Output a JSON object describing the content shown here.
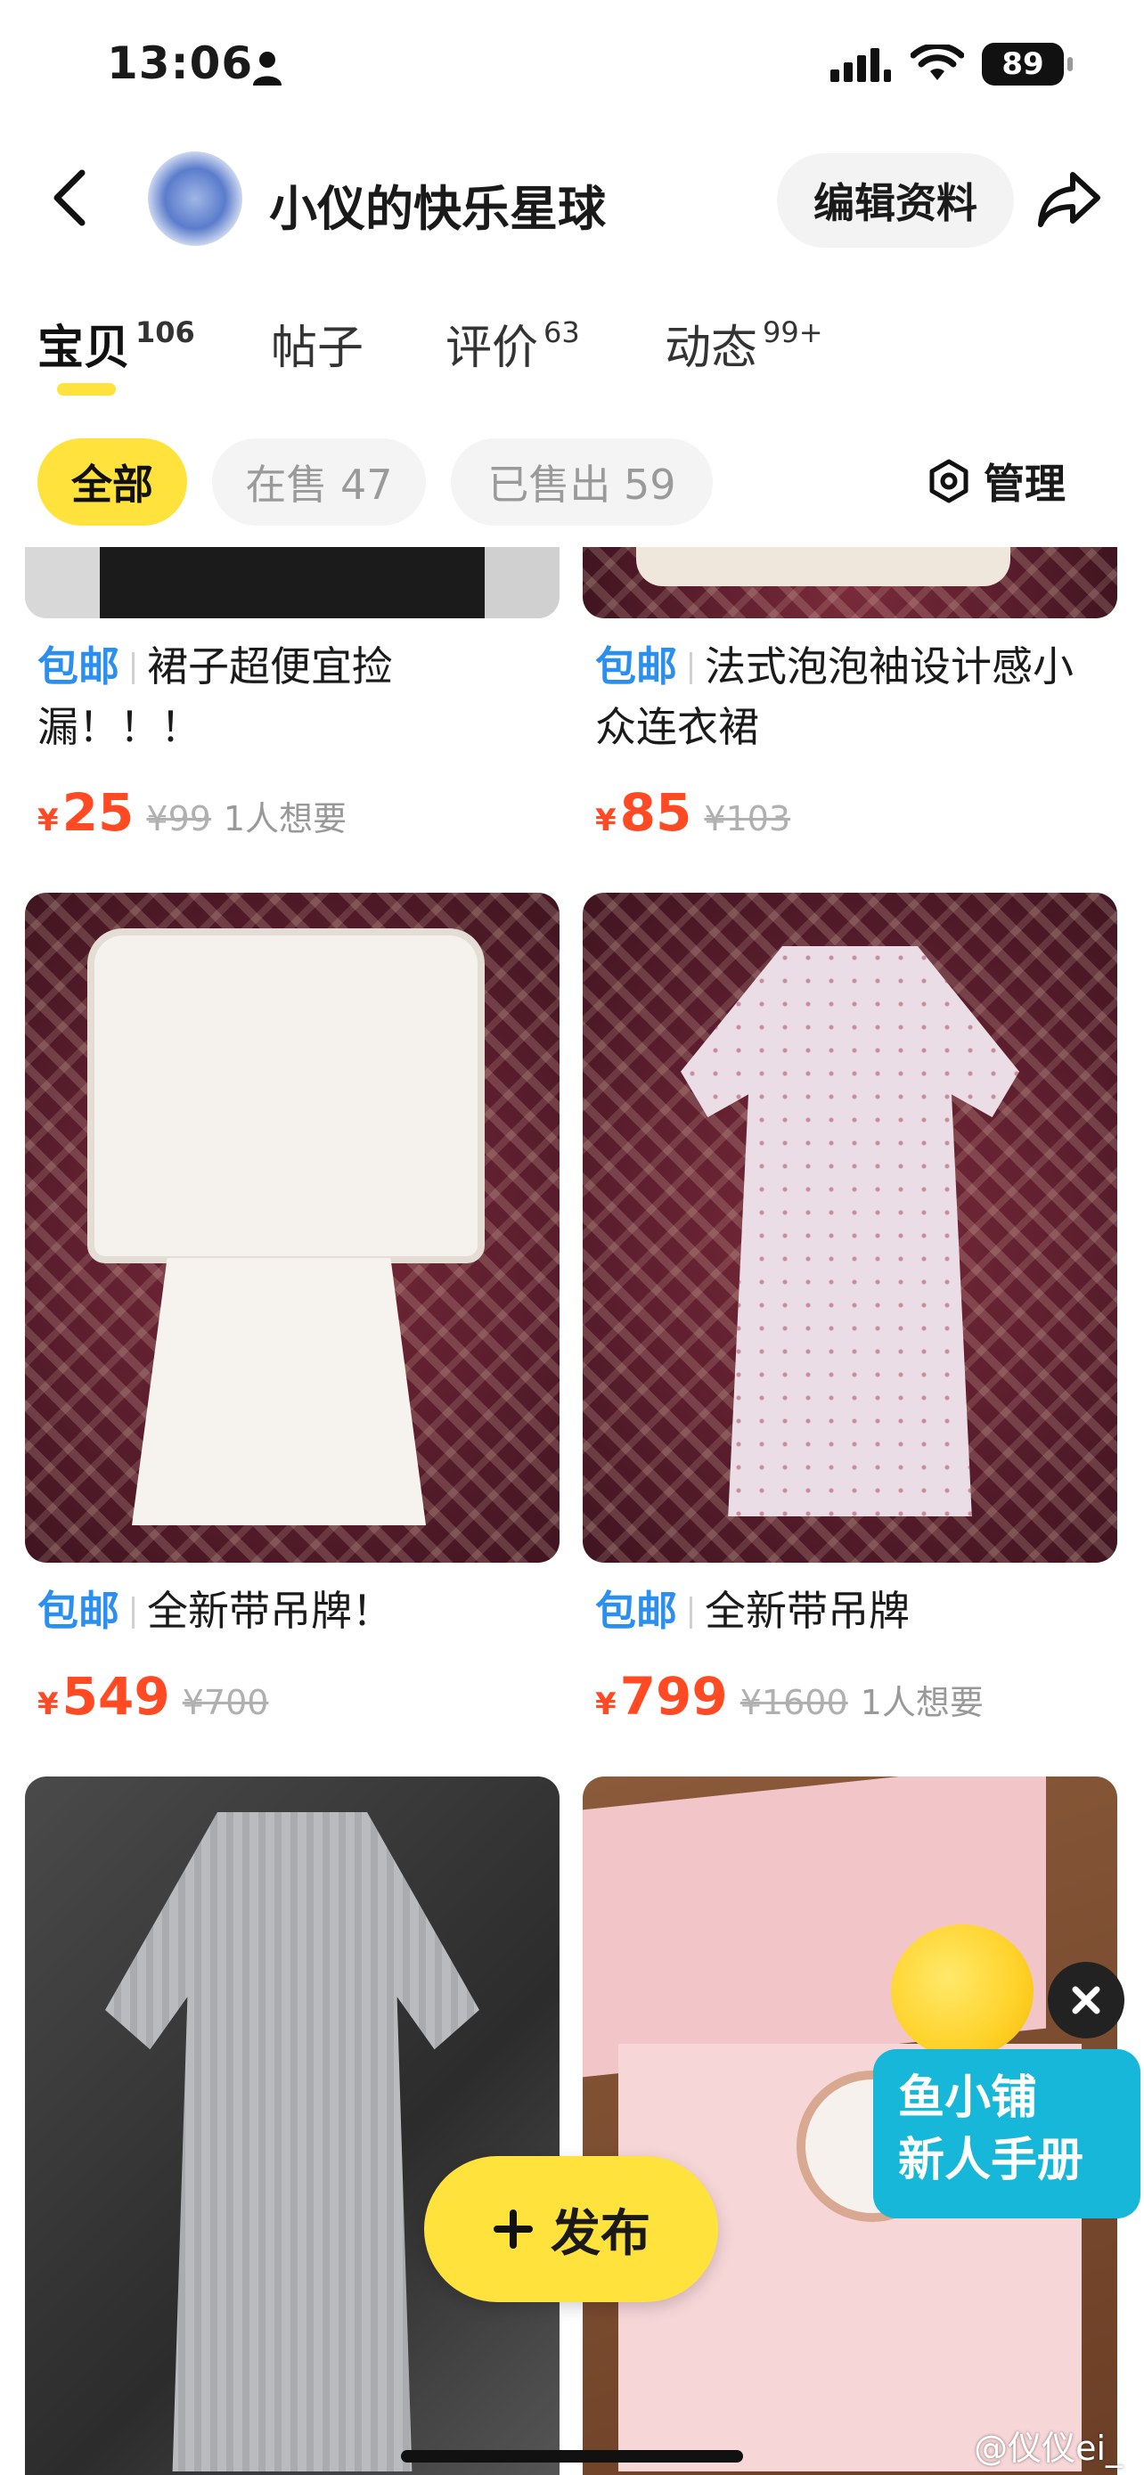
{
  "status_bar": {
    "time": "13:06",
    "battery": "89"
  },
  "header": {
    "shop_name": "小仪的快乐星球",
    "edit_label": "编辑资料"
  },
  "tabs": [
    {
      "label": "宝贝",
      "count": "106"
    },
    {
      "label": "帖子",
      "count": ""
    },
    {
      "label": "评价",
      "count": "63"
    },
    {
      "label": "动态",
      "count": "99+"
    }
  ],
  "filters": [
    {
      "label": "全部"
    },
    {
      "label": "在售 47"
    },
    {
      "label": "已售出 59"
    }
  ],
  "manage_label": "管理",
  "products": [
    {
      "tag": "包邮",
      "title_line1": "裙子超便宜捡",
      "title_line2": "漏！！！",
      "yen": "¥",
      "price": "25",
      "orig": "¥99",
      "want": "1人想要"
    },
    {
      "tag": "包邮",
      "title_line1": "法式泡泡袖设计感小",
      "title_line2": "众连衣裙",
      "yen": "¥",
      "price": "85",
      "orig": "¥103",
      "want": ""
    },
    {
      "tag": "包邮",
      "title_line1": "全新带吊牌！",
      "title_line2": "",
      "yen": "¥",
      "price": "549",
      "orig": "¥700",
      "want": ""
    },
    {
      "tag": "包邮",
      "title_line1": "全新带吊牌",
      "title_line2": "",
      "yen": "¥",
      "price": "799",
      "orig": "¥1600",
      "want": "1人想要"
    }
  ],
  "publish_label": "发布",
  "promo": {
    "line1": "鱼小铺",
    "line2": "新人手册"
  },
  "watermark": "@仪仪ei_",
  "colors": {
    "accent_yellow": "#ffe23b",
    "price_red": "#ff4a24",
    "tag_blue": "#2b8ff0"
  }
}
